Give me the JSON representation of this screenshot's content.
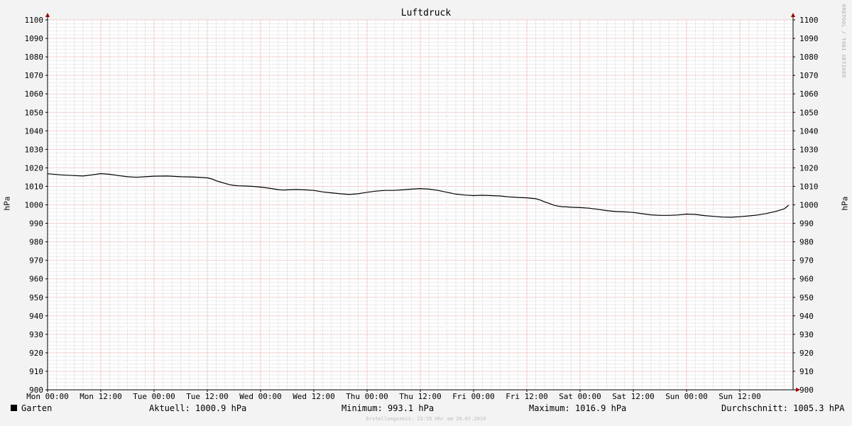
{
  "title": "Luftdruck",
  "watermark": "RRDTOOL / TOBI OETIKER",
  "footer": "Erstellungszeit: 23:55 Uhr am 28.07.2019",
  "legend": {
    "series_name": "Garten",
    "series_color": "#000000",
    "aktuell": "Aktuell: 1000.9 hPa",
    "minimum": "Minimum: 993.1 hPa",
    "maximum": "Maximum: 1016.9 hPa",
    "durchschnitt": "Durchschnitt: 1005.3 hPA"
  },
  "chart_data": {
    "type": "line",
    "title": "Luftdruck",
    "ylabel": "hPa",
    "ylabel_right": "hPa",
    "ylim": [
      900,
      1100
    ],
    "yticks": [
      900,
      910,
      920,
      930,
      940,
      950,
      960,
      970,
      980,
      990,
      1000,
      1010,
      1020,
      1030,
      1040,
      1050,
      1060,
      1070,
      1080,
      1090,
      1100
    ],
    "xlim": [
      0,
      168
    ],
    "xticks": [
      {
        "x": 0,
        "label": "Mon 00:00"
      },
      {
        "x": 12,
        "label": "Mon 12:00"
      },
      {
        "x": 24,
        "label": "Tue 00:00"
      },
      {
        "x": 36,
        "label": "Tue 12:00"
      },
      {
        "x": 48,
        "label": "Wed 00:00"
      },
      {
        "x": 60,
        "label": "Wed 12:00"
      },
      {
        "x": 72,
        "label": "Thu 00:00"
      },
      {
        "x": 84,
        "label": "Thu 12:00"
      },
      {
        "x": 96,
        "label": "Fri 00:00"
      },
      {
        "x": 108,
        "label": "Fri 12:00"
      },
      {
        "x": 120,
        "label": "Sat 00:00"
      },
      {
        "x": 132,
        "label": "Sat 12:00"
      },
      {
        "x": 144,
        "label": "Sun 00:00"
      },
      {
        "x": 156,
        "label": "Sun 12:00"
      }
    ],
    "grid": true,
    "colors": {
      "major_grid": "#e6a0a0",
      "minor_grid": "#d8d8d8",
      "axis": "#000000",
      "arrow": "#a00000",
      "line": "#000000"
    },
    "series": [
      {
        "name": "Garten",
        "x": [
          0,
          3,
          6,
          8,
          10,
          12,
          14,
          16,
          18,
          20,
          22,
          24,
          27,
          30,
          33,
          36,
          37,
          38,
          39,
          40,
          41,
          42,
          43,
          44,
          46,
          48,
          50,
          51,
          52,
          53,
          54,
          55,
          56,
          58,
          60,
          62,
          64,
          66,
          68,
          70,
          72,
          74,
          76,
          78,
          80,
          82,
          84,
          86,
          88,
          90,
          92,
          94,
          96,
          98,
          100,
          102,
          104,
          106,
          108,
          110,
          111,
          112,
          113,
          114,
          115,
          116,
          117,
          118,
          120,
          122,
          124,
          126,
          128,
          130,
          132,
          134,
          136,
          138,
          140,
          142,
          144,
          146,
          148,
          150,
          152,
          154,
          156,
          158,
          160,
          162,
          164,
          166,
          167
        ],
        "values": [
          1016.8,
          1016.2,
          1015.8,
          1015.6,
          1016.2,
          1016.9,
          1016.5,
          1015.8,
          1015.2,
          1014.9,
          1015.2,
          1015.5,
          1015.6,
          1015.2,
          1015.0,
          1014.6,
          1014.0,
          1013.0,
          1012.3,
          1011.6,
          1010.9,
          1010.5,
          1010.3,
          1010.2,
          1010.0,
          1009.6,
          1009.0,
          1008.6,
          1008.2,
          1008.0,
          1008.1,
          1008.2,
          1008.3,
          1008.1,
          1007.8,
          1007.0,
          1006.5,
          1006.0,
          1005.6,
          1006.0,
          1006.8,
          1007.4,
          1007.8,
          1007.8,
          1008.1,
          1008.5,
          1008.8,
          1008.5,
          1007.8,
          1006.8,
          1005.8,
          1005.3,
          1005.0,
          1005.2,
          1005.0,
          1004.8,
          1004.3,
          1004.0,
          1003.8,
          1003.3,
          1002.6,
          1001.6,
          1000.8,
          999.9,
          999.3,
          999.0,
          998.9,
          998.7,
          998.5,
          998.2,
          997.6,
          996.9,
          996.4,
          996.2,
          995.9,
          995.2,
          994.6,
          994.3,
          994.3,
          994.5,
          995.0,
          994.8,
          994.2,
          993.8,
          993.4,
          993.3,
          993.6,
          994.0,
          994.5,
          995.3,
          996.4,
          997.8,
          999.8
        ]
      }
    ]
  }
}
